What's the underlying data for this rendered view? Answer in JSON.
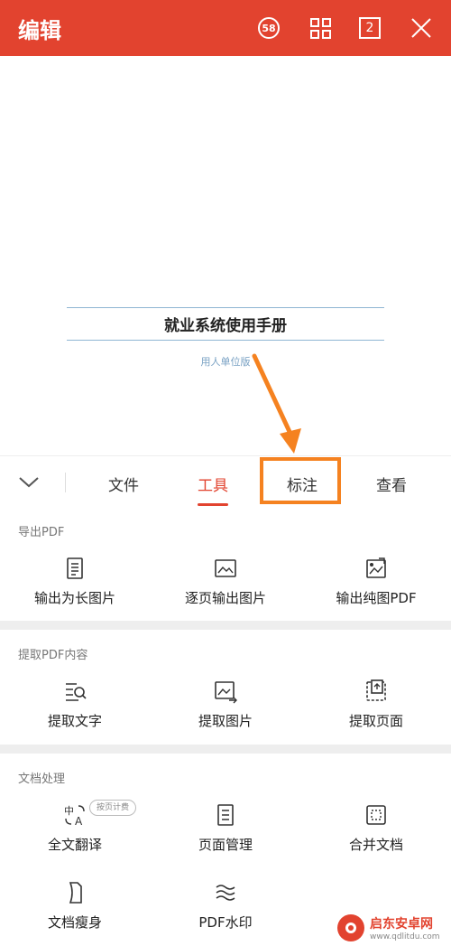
{
  "topbar": {
    "title": "编辑",
    "badge_58": "58",
    "page_count": "2"
  },
  "document": {
    "title": "就业系统使用手册",
    "subtitle": "用人单位版"
  },
  "tabs": {
    "file": "文件",
    "tools": "工具",
    "annotate": "标注",
    "view": "查看"
  },
  "sections": {
    "export": {
      "title": "导出PDF",
      "items": [
        "输出为长图片",
        "逐页输出图片",
        "输出纯图PDF"
      ]
    },
    "extract": {
      "title": "提取PDF内容",
      "items": [
        "提取文字",
        "提取图片",
        "提取页面"
      ]
    },
    "process": {
      "title": "文档处理",
      "items": [
        "全文翻译",
        "页面管理",
        "合并文档",
        "文档瘦身",
        "PDF水印"
      ],
      "badge": "按页计费"
    }
  },
  "watermark": {
    "title": "启东安卓网",
    "url": "www.qdlitdu.com"
  },
  "colors": {
    "accent": "#e2432f",
    "highlight": "#f58220"
  }
}
